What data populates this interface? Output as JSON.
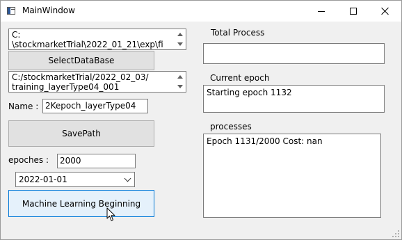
{
  "window": {
    "title": "MainWindow",
    "controls": {
      "minimize": "minimize-icon",
      "maximize": "maximize-icon",
      "close": "close-icon"
    }
  },
  "left": {
    "db_path_lines": [
      "C:",
      "\\stockmarketTrial\\2022_01_21\\exp\\fi"
    ],
    "select_db_label": "SelectDataBase",
    "save_path_lines": [
      "C:/stockmarketTrial/2022_02_03/",
      "training_layerType04_001"
    ],
    "name_label": "Name :",
    "name_value": "2Kepoch_layerType04",
    "save_path_label": "SavePath",
    "epochs_label": "epoches :",
    "epochs_value": "2000",
    "date_value": "2022-01-01",
    "run_label": "Machine Learning Beginning"
  },
  "right": {
    "total_process_label": "Total Process",
    "total_process_value": "",
    "current_epoch_label": "Current epoch",
    "current_epoch_value": "Starting epoch 1132",
    "processes_label": "processes",
    "processes_value": "Epoch 1131/2000 Cost: nan"
  }
}
